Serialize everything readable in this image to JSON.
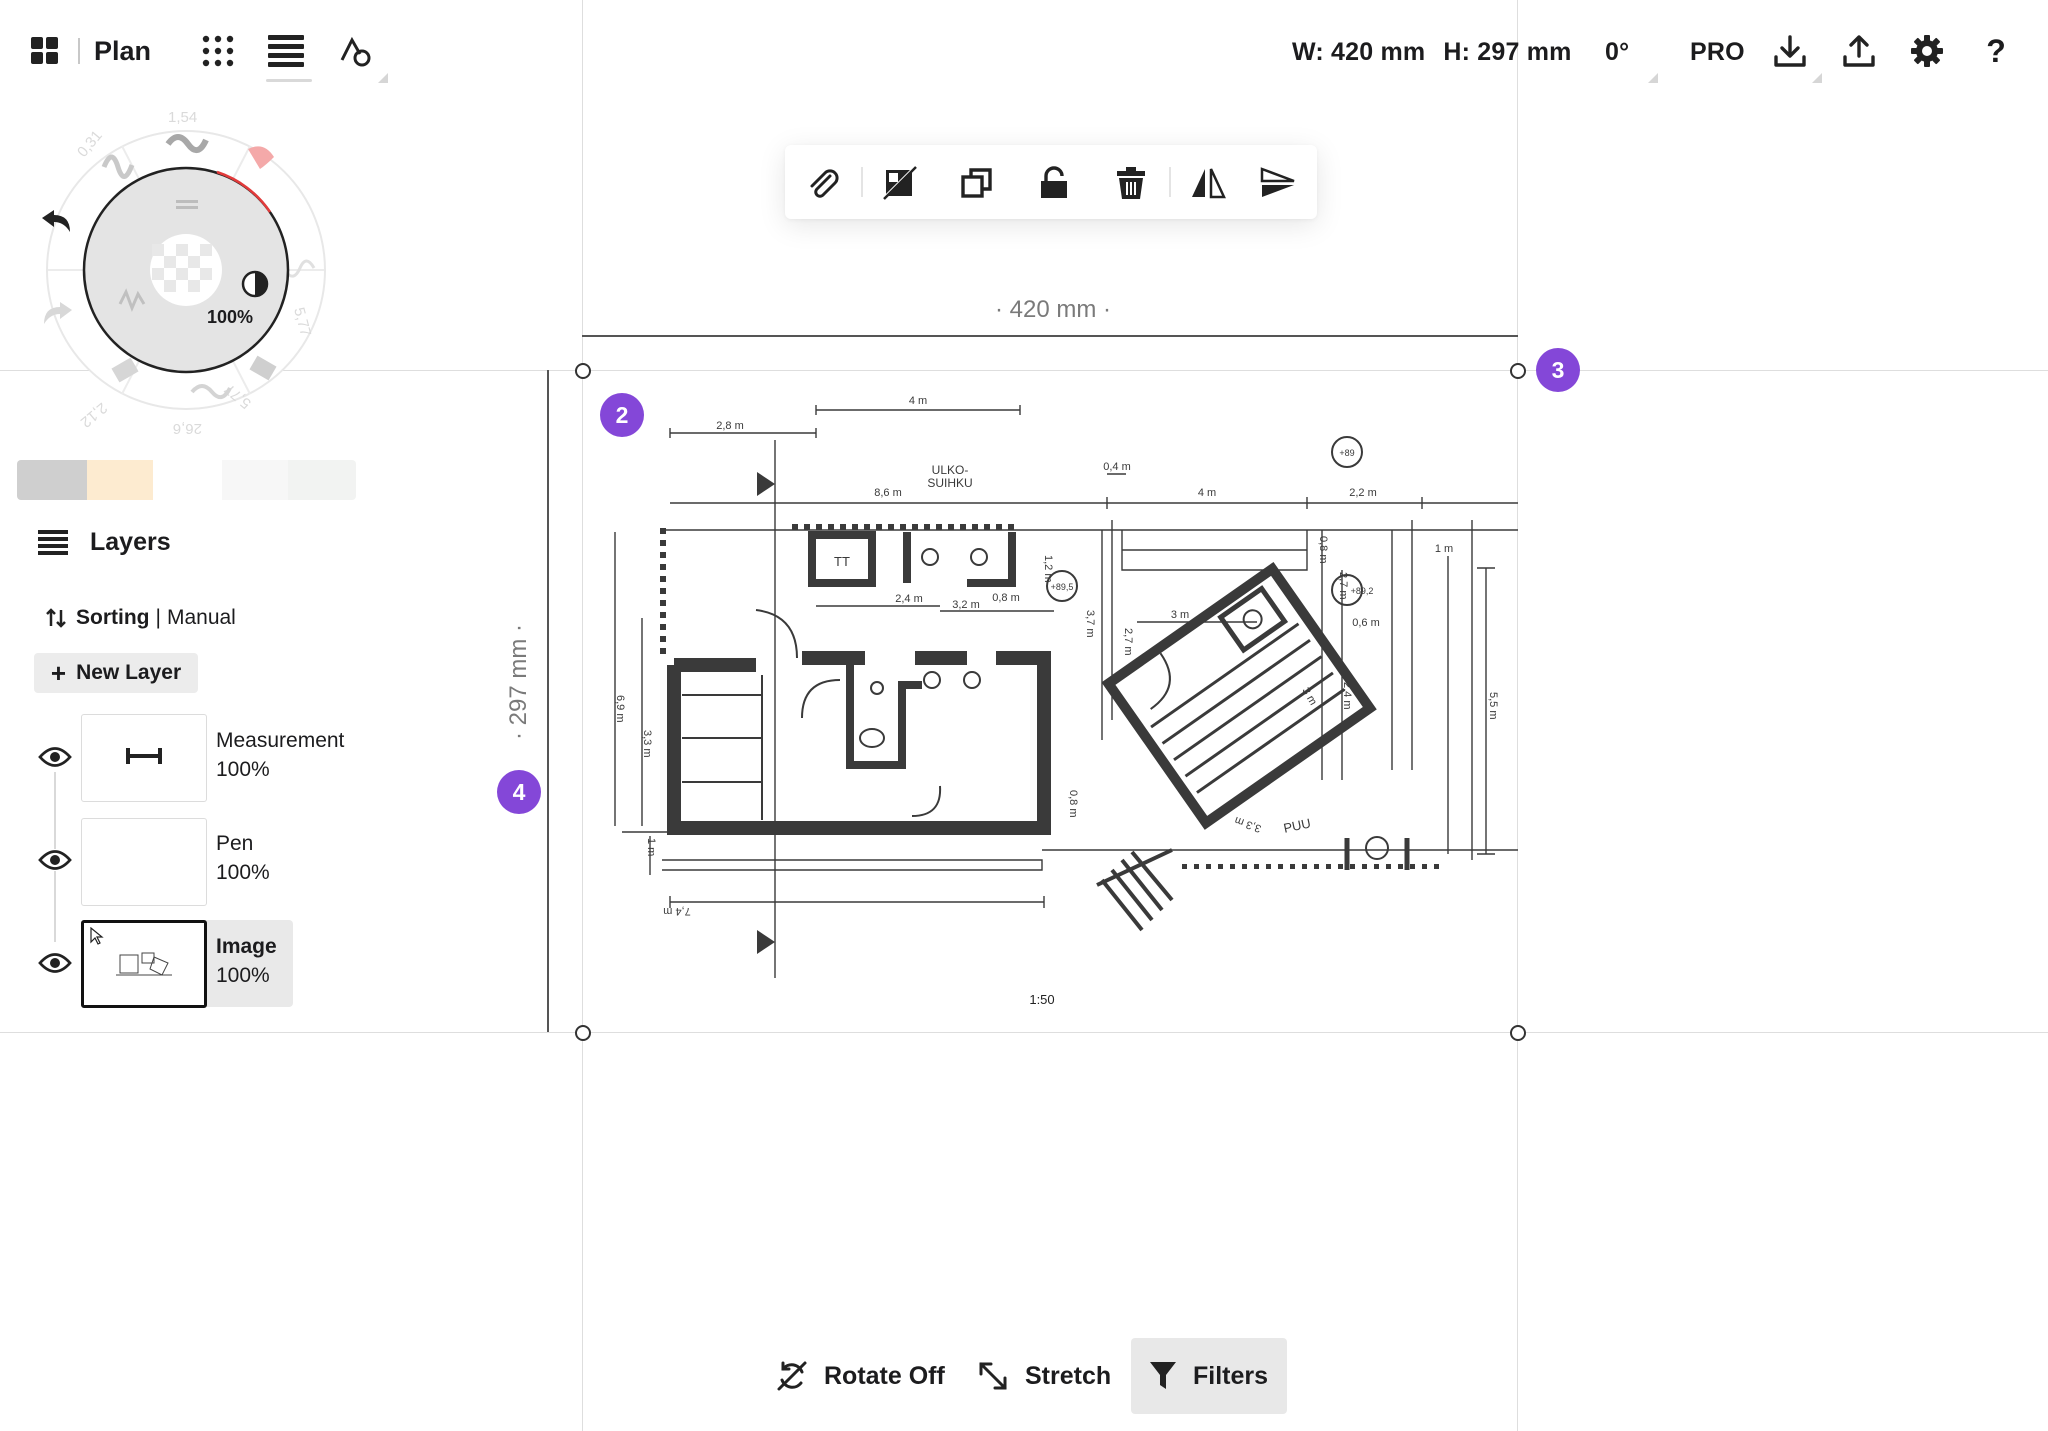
{
  "app": {
    "title": "Plan"
  },
  "document": {
    "width_label": "W: 420 mm",
    "height_label": "H: 297 mm",
    "rotation_label": "0°",
    "pro_label": "PRO"
  },
  "brush": {
    "opacity": "100%",
    "sizes": [
      "0,31",
      "1,54",
      "5,77",
      "5,77",
      "26,6",
      "2,12"
    ]
  },
  "canvas": {
    "dim_width": "· 420 mm ·",
    "dim_height": "· 297 mm ·",
    "scale": "1:50",
    "badges": [
      "2",
      "3",
      "4"
    ]
  },
  "plan_labels": {
    "d1": "2,8 m",
    "d2": "4 m",
    "d3": "8,6 m",
    "d4": "0,4 m",
    "d5": "4 m",
    "d6": "2,2 m",
    "d7": "1 m",
    "d8": "0,8 m",
    "d9": "2,4 m",
    "d10": "3,2 m",
    "d11": "0,8 m",
    "d12": "1,2 m",
    "d13": "3 m",
    "d14": "0,6 m",
    "d15": "3,7 m",
    "d16": "2,7 m",
    "d17": "6,9 m",
    "d18": "3,3 m",
    "d19": "3 m",
    "d20": "2,4 m",
    "d21": "5,5 m",
    "d22": "0,8 m",
    "d23": "7,4 m",
    "d24": "3,3 m",
    "d25": "1 m",
    "d26": "2,7 m",
    "e1": "+89",
    "e2": "+89,5",
    "e3": "+89,2",
    "n1": "ULKO-",
    "n2": "SUIHKU",
    "n3": "PUU",
    "n4": "TT"
  },
  "layers": {
    "title": "Layers",
    "sorting_label": "Sorting",
    "sorting_value": "Manual",
    "new_layer": "New Layer",
    "items": [
      {
        "name": "Measurement",
        "opacity": "100%"
      },
      {
        "name": "Pen",
        "opacity": "100%"
      },
      {
        "name": "Image",
        "opacity": "100%",
        "selected": true
      }
    ]
  },
  "bottom_toolbar": {
    "rotate": "Rotate Off",
    "stretch": "Stretch",
    "filters": "Filters"
  },
  "colors": {
    "accent_badge": "#8447d8",
    "swatches": [
      "#cfcfcf",
      "#fdebd0",
      "#f7f7f7",
      "#f2f3f2"
    ]
  },
  "icons": {
    "apps": "grid-icon",
    "dots": "dots-grid-icon",
    "layers": "layers-icon",
    "shapes": "shapes-icon",
    "download": "download-icon",
    "upload": "upload-icon",
    "settings": "gear-icon",
    "help": "help-icon",
    "attach": "paperclip-icon",
    "no_fill": "no-fill-icon",
    "duplicate": "duplicate-icon",
    "lock": "lock-icon",
    "delete": "trash-icon",
    "flip_h": "flip-horizontal-icon",
    "flip_v": "flip-vertical-icon"
  }
}
